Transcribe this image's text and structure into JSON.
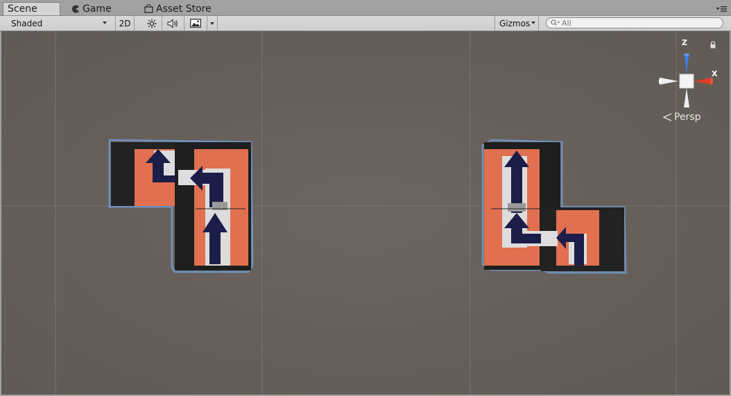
{
  "tabs": {
    "scene": "Scene",
    "game": "Game",
    "asset_store": "Asset Store"
  },
  "toolbar": {
    "draw_mode": "Shaded",
    "mode_2d": "2D",
    "gizmos": "Gizmos",
    "search_placeholder": "All"
  },
  "viewport": {
    "projection": "Persp",
    "axes": {
      "z": "Z",
      "x": "X"
    },
    "colors": {
      "background": "#6a635d",
      "floor": "#e07050",
      "wall": "#222222",
      "arrow": "#1c1d48",
      "outline": "#6f8fb8",
      "axis_z": "#3b7ee6",
      "axis_x": "#e03c28"
    }
  }
}
